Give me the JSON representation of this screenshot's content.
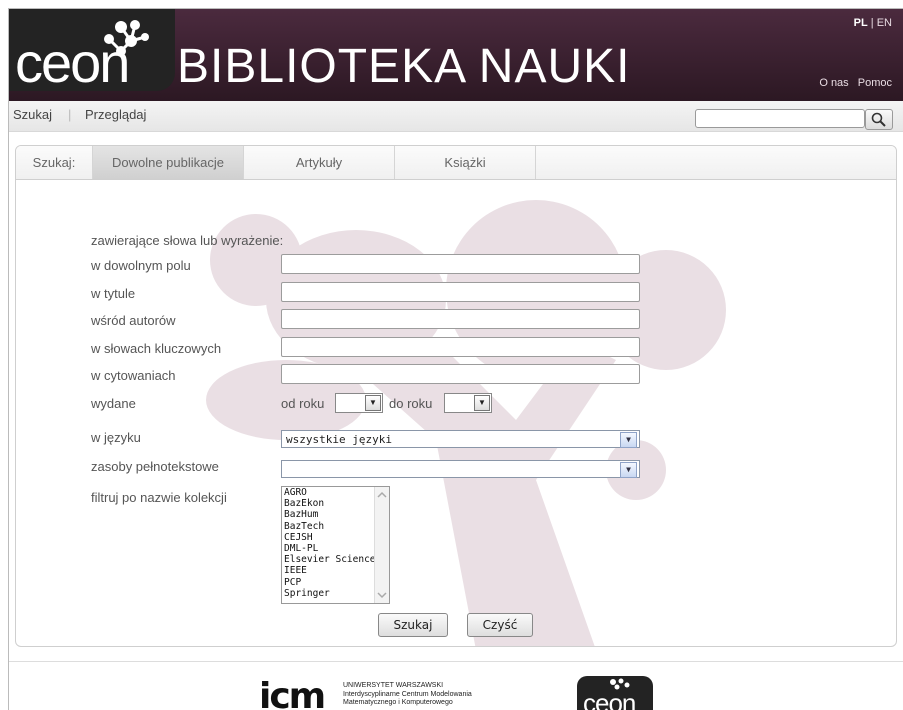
{
  "header": {
    "logo_text": "ceon",
    "brand": "BIBLIOTEKA NAUKI",
    "lang_pl": "PL",
    "lang_sep": " | ",
    "lang_en": "EN",
    "about": "O nas",
    "help": "Pomoc"
  },
  "nav": {
    "search": "Szukaj",
    "browse": "Przeglądaj",
    "search_value": ""
  },
  "tabs": {
    "label": "Szukaj:",
    "items": [
      "Dowolne publikacje",
      "Artykuły",
      "Książki"
    ]
  },
  "form": {
    "intro": "zawierające słowa lub wyrażenie:",
    "any_field": "w dowolnym polu",
    "title": "w tytule",
    "authors": "wśród autorów",
    "keywords": "w słowach kluczowych",
    "citations": "w cytowaniach",
    "published": "wydane",
    "from_year": "od roku",
    "to_year": "do roku",
    "language": "w języku",
    "language_value": "wszystkie języki",
    "fulltext": "zasoby pełnotekstowe",
    "fulltext_value": "",
    "collection": "filtruj po nazwie kolekcji",
    "collections": [
      "AGRO",
      "BazEkon",
      "BazHum",
      "BazTech",
      "CEJSH",
      "DML-PL",
      "Elsevier Science",
      "IEEE",
      "PCP",
      "Springer"
    ],
    "search_button": "Szukaj",
    "clear_button": "Czyść"
  },
  "footer": {
    "icm_logo": "icm",
    "icm_line1": "UNIWERSYTET WARSZAWSKI",
    "icm_line2": "Interdyscyplinarne Centrum Modelowania",
    "icm_line3": "Matematycznego i Komputerowego",
    "ceon_logo": "ceon"
  },
  "colors": {
    "header_bg": "#3a2131",
    "art": "#eadfe4"
  }
}
